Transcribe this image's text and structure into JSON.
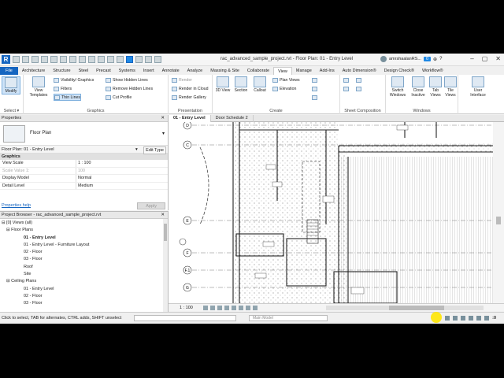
{
  "window": {
    "title": "rac_advanced_sample_project.rvt - Floor Plan: 01 - Entry Level",
    "user": "amrshaalanRS...",
    "badge": "0",
    "logo": "R"
  },
  "ribbon_tabs": [
    "File",
    "Architecture",
    "Structure",
    "Steel",
    "Precast",
    "Systems",
    "Insert",
    "Annotate",
    "Analyze",
    "Massing & Site",
    "Collaborate",
    "View",
    "Manage",
    "Add-Ins",
    "Auto Dimension®",
    "Design Check®",
    "Workflow®"
  ],
  "active_tab": "View",
  "ribbon": {
    "select": {
      "modify": "Modify",
      "label": "Select ▾"
    },
    "graphics": {
      "view_templates": "View Templates",
      "visibility": "Visibility/ Graphics",
      "filters": "Filters",
      "thin_lines": "Thin Lines",
      "show_hidden": "Show Hidden Lines",
      "remove_hidden": "Remove Hidden Lines",
      "cut_profile": "Cut Profile",
      "label": "Graphics"
    },
    "presentation": {
      "render": "Render",
      "render_cloud": "Render in Cloud",
      "render_gallery": "Render Gallery",
      "label": "Presentation"
    },
    "create": {
      "view_3d": "3D View",
      "section": "Section",
      "callout": "Callout",
      "plan_views": "Plan Views",
      "elevation": "Elevation",
      "label": "Create"
    },
    "sheet_composition": {
      "label": "Sheet Composition"
    },
    "windows": {
      "switch": "Switch Windows",
      "close_inactive": "Close Inactive",
      "tab_views": "Tab Views",
      "tile_views": "Tile Views",
      "user_interface": "User Interface",
      "label": "Windows"
    }
  },
  "properties": {
    "header": "Properties",
    "type_name": "Floor Plan",
    "instance": "Floor Plan: 01 - Entry Level",
    "edit_type": "Edit Type",
    "section": "Graphics",
    "rows": [
      {
        "k": "View Scale",
        "v": "1 : 100"
      },
      {
        "k": "Scale Value  1:",
        "v": "100"
      },
      {
        "k": "Display Model",
        "v": "Normal"
      },
      {
        "k": "Detail Level",
        "v": "Medium"
      }
    ],
    "help": "Properties help",
    "apply": "Apply"
  },
  "browser": {
    "header": "Project Browser - rac_advanced_sample_project.rvt",
    "items": [
      "⊟ [0] Views (all)",
      "⊟ Floor Plans",
      "01 - Entry Level",
      "01 - Entry Level - Furniture Layout",
      "02 - Floor",
      "03 - Floor",
      "Roof",
      "Site",
      "⊟ Ceiling Plans",
      "01 - Entry Level",
      "02 - Floor",
      "03 - Floor"
    ]
  },
  "view_tabs": [
    {
      "label": "01 - Entry Level",
      "active": true
    },
    {
      "label": "Door Schedule 2",
      "active": false
    }
  ],
  "viewbar": {
    "scale": "1 : 100"
  },
  "status": {
    "message": "Click to select, TAB for alternates, CTRL adds, SHIFT unselect",
    "model": "Main Model",
    "filter": ":0"
  },
  "grid_labels": [
    "D",
    "C",
    "E",
    "F",
    "F.1",
    "G"
  ]
}
